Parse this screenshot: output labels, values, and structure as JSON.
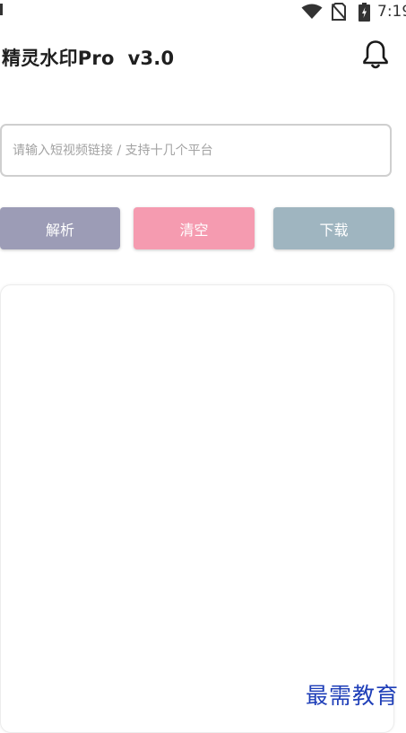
{
  "status_bar": {
    "time": "7:19",
    "icons": [
      "wifi-icon",
      "no-sim-icon",
      "battery-charging-icon"
    ]
  },
  "header": {
    "title": "精灵水印Pro  v3.0",
    "notification_icon": "bell-icon"
  },
  "url_input": {
    "value": "",
    "placeholder": "请输入短视频链接 / 支持十几个平台"
  },
  "buttons": {
    "parse_label": "解析",
    "clear_label": "清空",
    "download_label": "下载"
  },
  "colors": {
    "parse_button": "#9c9cb6",
    "clear_button": "#f59bb0",
    "download_button": "#9fb5c0",
    "watermark": "#1f3fb8"
  },
  "watermark": {
    "text": "最需教育"
  }
}
